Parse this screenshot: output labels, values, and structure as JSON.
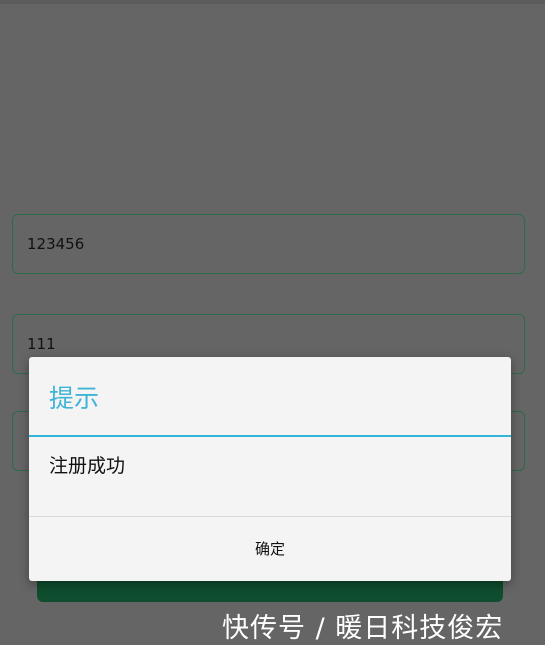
{
  "form": {
    "field1_value": "123456",
    "field2_value": "111",
    "field3_value": ""
  },
  "dialog": {
    "title": "提示",
    "message": "注册成功",
    "confirm_label": "确定"
  },
  "watermark": "快传号 / 暖日科技俊宏",
  "colors": {
    "overlay": "#656565",
    "dialog_title": "#3fb4d6",
    "field_border": "#2e6b4c",
    "button_bg": "#0e4d2d"
  }
}
